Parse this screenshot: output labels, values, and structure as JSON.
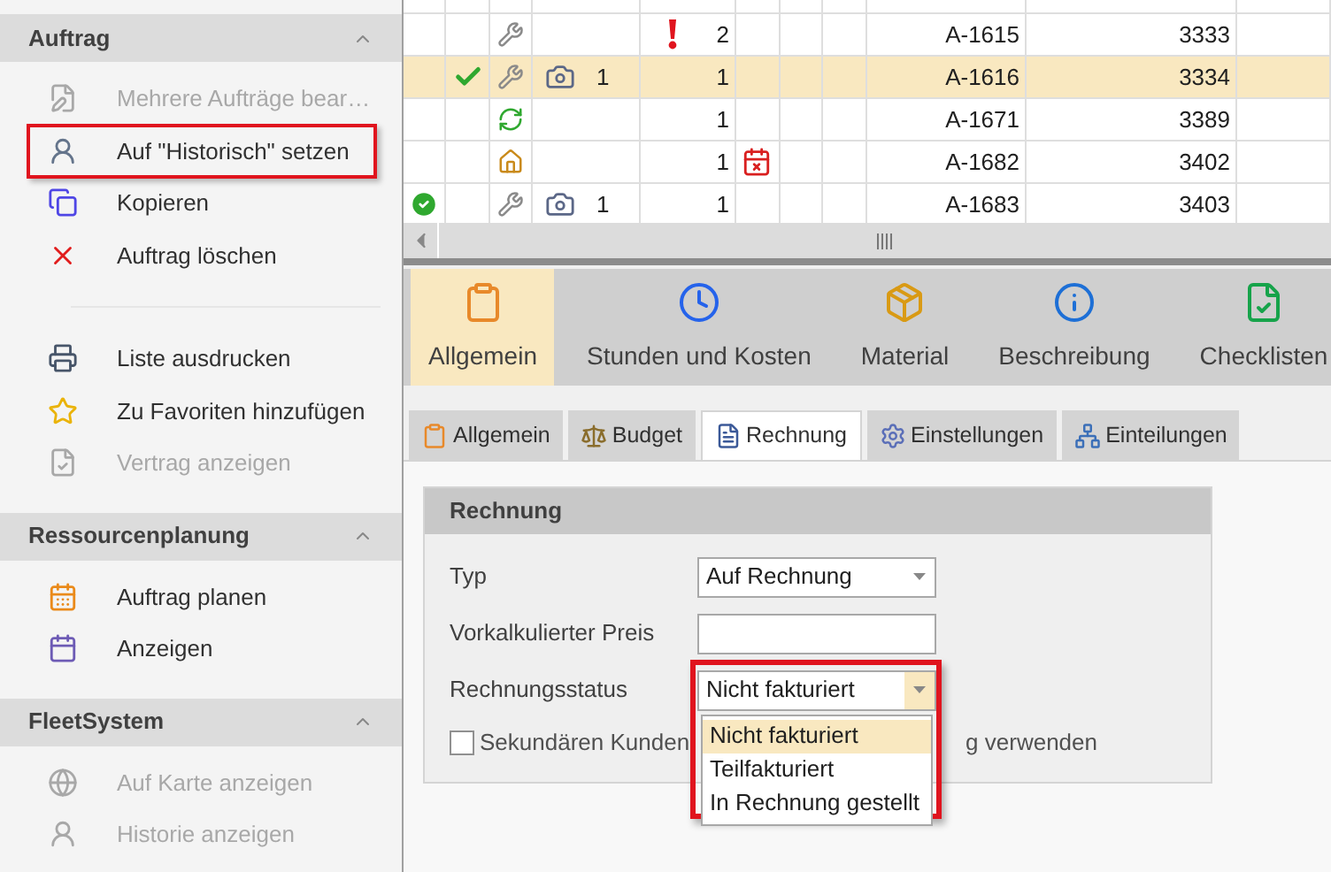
{
  "sidebar": {
    "sections": [
      {
        "title": "Auftrag",
        "expanded": true,
        "groups": [
          [
            {
              "label": "Mehrere Aufträge bear…",
              "kind": "edit",
              "disabled": true,
              "highlighted": false
            },
            {
              "label": "Auf \"Historisch\" setzen",
              "kind": "history",
              "disabled": false,
              "highlighted": true
            },
            {
              "label": "Kopieren",
              "kind": "copy",
              "disabled": false,
              "highlighted": false
            },
            {
              "label": "Auftrag löschen",
              "kind": "delete",
              "disabled": false,
              "highlighted": false
            }
          ],
          [
            {
              "label": "Liste ausdrucken",
              "kind": "print",
              "disabled": false,
              "highlighted": false
            },
            {
              "label": "Zu Favoriten hinzufügen",
              "kind": "star",
              "disabled": false,
              "highlighted": false
            },
            {
              "label": "Vertrag anzeigen",
              "kind": "contract",
              "disabled": true,
              "highlighted": false
            }
          ]
        ]
      },
      {
        "title": "Ressourcenplanung",
        "expanded": true,
        "groups": [
          [
            {
              "label": "Auftrag planen",
              "kind": "plan",
              "disabled": false,
              "highlighted": false
            },
            {
              "label": "Anzeigen",
              "kind": "calendar",
              "disabled": false,
              "highlighted": false
            }
          ]
        ]
      },
      {
        "title": "FleetSystem",
        "expanded": true,
        "groups": [
          [
            {
              "label": "Auf Karte anzeigen",
              "kind": "map",
              "disabled": true,
              "highlighted": false
            },
            {
              "label": "Historie anzeigen",
              "kind": "history",
              "disabled": true,
              "highlighted": false
            }
          ]
        ]
      }
    ]
  },
  "grid": {
    "rows": [
      {
        "selected": false,
        "done": false,
        "checked": false,
        "kind": "service",
        "attachments": null,
        "priority": true,
        "count": "2",
        "calendar_warning": false,
        "order": "A-1615",
        "number": "3333"
      },
      {
        "selected": true,
        "done": false,
        "checked": true,
        "kind": "service",
        "attachments": "1",
        "priority": false,
        "count": "1",
        "calendar_warning": false,
        "order": "A-1616",
        "number": "3334"
      },
      {
        "selected": false,
        "done": false,
        "checked": false,
        "kind": "recycle",
        "attachments": null,
        "priority": false,
        "count": "1",
        "calendar_warning": false,
        "order": "A-1671",
        "number": "3389"
      },
      {
        "selected": false,
        "done": false,
        "checked": false,
        "kind": "house",
        "attachments": null,
        "priority": false,
        "count": "1",
        "calendar_warning": true,
        "order": "A-1682",
        "number": "3402"
      },
      {
        "selected": false,
        "done": true,
        "checked": false,
        "kind": "service",
        "attachments": "1",
        "priority": false,
        "count": "1",
        "calendar_warning": false,
        "order": "A-1683",
        "number": "3403"
      }
    ]
  },
  "pages": [
    {
      "label": "Allgemein",
      "kind": "clipboard",
      "selected": true
    },
    {
      "label": "Stunden und Kosten",
      "kind": "clock",
      "selected": false
    },
    {
      "label": "Material",
      "kind": "box",
      "selected": false
    },
    {
      "label": "Beschreibung",
      "kind": "info",
      "selected": false
    },
    {
      "label": "Checklisten",
      "kind": "checklist",
      "selected": false
    }
  ],
  "tabs": [
    {
      "label": "Allgemein",
      "kind": "clipboard",
      "selected": false
    },
    {
      "label": "Budget",
      "kind": "scale",
      "selected": false
    },
    {
      "label": "Rechnung",
      "kind": "invoice",
      "selected": true
    },
    {
      "label": "Einstellungen",
      "kind": "settings",
      "selected": false
    },
    {
      "label": "Einteilungen",
      "kind": "tree",
      "selected": false
    }
  ],
  "invoice_panel": {
    "title": "Rechnung",
    "fields": [
      {
        "kind": "combo",
        "label": "Typ",
        "value": "Auf Rechnung",
        "open": false,
        "highlighted": false
      },
      {
        "kind": "text",
        "label": "Vorkalkulierter Preis"
      },
      {
        "kind": "combo",
        "label": "Rechnungsstatus",
        "value": "Nicht fakturiert",
        "open": true,
        "highlighted": true,
        "options": [
          {
            "label": "Nicht fakturiert",
            "selected": true
          },
          {
            "label": "Teilfakturiert",
            "selected": false
          },
          {
            "label": "In Rechnung gestellt",
            "selected": false
          }
        ]
      }
    ],
    "checkbox": {
      "checked": false,
      "label": "Sekundären Kunden",
      "label_tail": "g verwenden"
    }
  }
}
